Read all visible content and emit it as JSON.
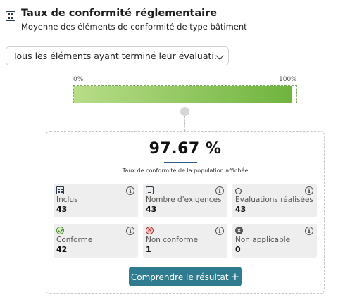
{
  "header": {
    "title": "Taux de conformité réglementaire",
    "subtitle": "Moyenne des éléments de conformité de type bâtiment",
    "icon": "building-grid-icon"
  },
  "filter": {
    "selected": "Tous les éléments ayant terminé leur évaluati..."
  },
  "gauge": {
    "min_label": "0%",
    "max_label": "100%",
    "value_percent": 97.67,
    "fill_color_start": "#b8dd88",
    "fill_color_end": "#6fb43e"
  },
  "result": {
    "rate": "97.67 %",
    "caption": "Taux de conformité de la population affichée"
  },
  "stats": [
    {
      "label": "Inclus",
      "value": "43",
      "icon": "building-grid-icon",
      "info": "i"
    },
    {
      "label": "Nombre d'exigences",
      "value": "43",
      "icon": "document-icon",
      "info": "i"
    },
    {
      "label": "Evaluations réalisées",
      "value": "43",
      "icon": "medal-icon",
      "info": "i"
    },
    {
      "label": "Conforme",
      "value": "42",
      "icon": "check-circle-icon",
      "info": "i"
    },
    {
      "label": "Non conforme",
      "value": "1",
      "icon": "x-circle-icon",
      "info": "i"
    },
    {
      "label": "Non applicable",
      "value": "0",
      "icon": "not-applicable-icon",
      "info": "i"
    }
  ],
  "action": {
    "label": "Comprendre le résultat",
    "plus": "+",
    "color": "#2f7c91"
  }
}
